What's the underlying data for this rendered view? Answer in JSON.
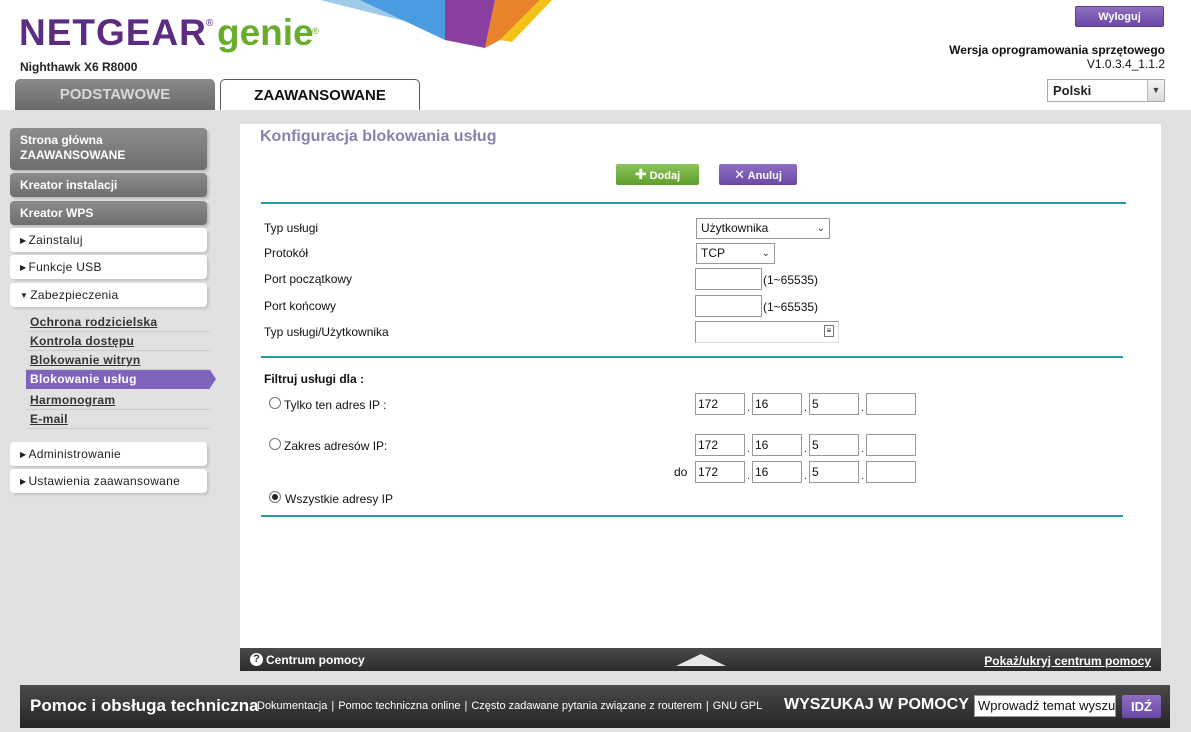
{
  "brand": {
    "name": "NETGEAR",
    "product": "genie",
    "reg_mark": "®",
    "tm_mark": "®"
  },
  "model": "Nighthawk X6 R8000",
  "header": {
    "logout_label": "Wyloguj",
    "firmware_label": "Wersja oprogramowania sprzętowego",
    "firmware_version": "V1.0.3.4_1.1.2",
    "language": "Polski"
  },
  "tabs": [
    {
      "label": "PODSTAWOWE",
      "active": false
    },
    {
      "label": "ZAAWANSOWANE",
      "active": true
    }
  ],
  "sidebar": {
    "home_line1": "Strona główna",
    "home_line2": "ZAAWANSOWANE",
    "setup_wizard": "Kreator instalacji",
    "wps_wizard": "Kreator WPS",
    "install": "Zainstaluj",
    "usb": "Funkcje USB",
    "security": "Zabezpieczenia",
    "security_items": [
      {
        "label": "Ochrona rodzicielska"
      },
      {
        "label": "Kontrola dostępu"
      },
      {
        "label": "Blokowanie witryn"
      },
      {
        "label": "Blokowanie usług",
        "active": true
      },
      {
        "label": "Harmonogram"
      },
      {
        "label": "E-mail"
      }
    ],
    "admin": "Administrowanie",
    "advanced_settings": "Ustawienia zaawansowane"
  },
  "main": {
    "title": "Konfiguracja blokowania usług",
    "add_label": "Dodaj",
    "cancel_label": "Anuluj",
    "service_type_label": "Typ usługi",
    "service_type_value": "Użytkownika",
    "protocol_label": "Protokół",
    "protocol_value": "TCP",
    "start_port_label": "Port początkowy",
    "start_port_value": "",
    "start_port_hint": "(1~65535)",
    "end_port_label": "Port końcowy",
    "end_port_value": "",
    "end_port_hint": "(1~65535)",
    "user_service_label": "Typ usługi/Użytkownika",
    "user_service_value": "",
    "filter_label": "Filtruj usługi dla :",
    "only_ip_label": "Tylko ten adres IP :",
    "only_ip": [
      "172",
      "16",
      "5",
      ""
    ],
    "range_label": "Zakres adresów IP:",
    "range_from": [
      "172",
      "16",
      "5",
      ""
    ],
    "to_label": "do",
    "range_to": [
      "172",
      "16",
      "5",
      ""
    ],
    "all_ip_label": "Wszystkie adresy IP",
    "selected_filter": "all"
  },
  "helpbar": {
    "icon_glyph": "?",
    "center_label": "Centrum pomocy",
    "toggle_label": "Pokaż/ukryj centrum pomocy"
  },
  "footer": {
    "title": "Pomoc i obsługa techniczna",
    "links": [
      "Dokumentacja",
      "Pomoc techniczna online",
      "Często zadawane pytania związane z routerem",
      "GNU GPL"
    ],
    "search_label": "WYSZUKAJ W POMOCY",
    "search_placeholder": "Wprowadź temat wyszukiwania",
    "go_label": "IDŹ"
  },
  "colors": {
    "netgear_purple": "#5a2d82",
    "genie_green": "#6aad2c",
    "accent_purple": "#7f63bd",
    "teal": "#2b9aa8"
  }
}
